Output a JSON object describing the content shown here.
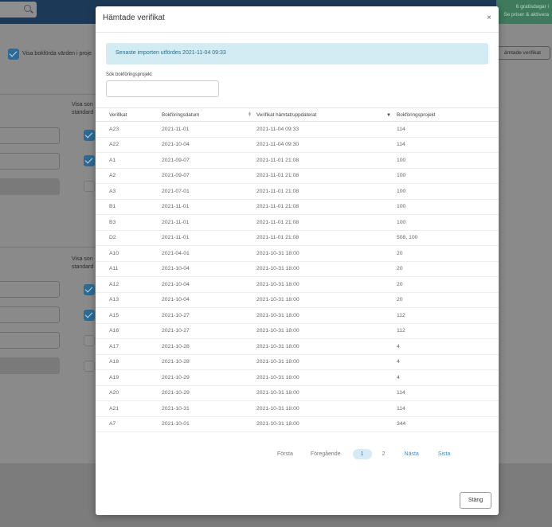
{
  "background": {
    "promo_line1": "6 gratisdagar i",
    "promo_line2": "Se priser & aktivera",
    "checkbox_label": "Visa bokförda värden i proje",
    "col_label_a1": "Visa son",
    "col_label_a2": "standard",
    "col_label_b1": "Visa son",
    "col_label_b2": "standard",
    "right_button": "ämtade verifikat"
  },
  "modal": {
    "title": "Hämtade verifikat",
    "close_glyph": "×",
    "alert_text": "Senaste importen utfördes 2021-11-04 09:33",
    "search_label": "Sök bokföringsprojekt",
    "search_value": "",
    "columns": [
      "Verifikat",
      "Bokföringsdatum",
      "Verifikat hämtat/uppdaterat",
      "Bokföringsprojekt"
    ],
    "rows": [
      [
        "A23",
        "2021-11-01",
        "2021-11-04 09:33",
        "114"
      ],
      [
        "A22",
        "2021-10-04",
        "2021-11-04 09:30",
        "114"
      ],
      [
        "A1",
        "2021-09-07",
        "2021-11-01 21:08",
        "100"
      ],
      [
        "A2",
        "2021-09-07",
        "2021-11-01 21:08",
        "100"
      ],
      [
        "A3",
        "2021-07-01",
        "2021-11-01 21:08",
        "100"
      ],
      [
        "B1",
        "2021-11-01",
        "2021-11-01 21:08",
        "100"
      ],
      [
        "B3",
        "2021-11-01",
        "2021-11-01 21:08",
        "100"
      ],
      [
        "D2",
        "2021-11-01",
        "2021-11-01 21:08",
        "508, 100"
      ],
      [
        "A10",
        "2021-04-01",
        "2021-10-31 18:00",
        "20"
      ],
      [
        "A11",
        "2021-10-04",
        "2021-10-31 18:00",
        "20"
      ],
      [
        "A12",
        "2021-10-04",
        "2021-10-31 18:00",
        "20"
      ],
      [
        "A13",
        "2021-10-04",
        "2021-10-31 18:00",
        "20"
      ],
      [
        "A15",
        "2021-10-27",
        "2021-10-31 18:00",
        "112"
      ],
      [
        "A16",
        "2021-10-27",
        "2021-10-31 18:00",
        "112"
      ],
      [
        "A17",
        "2021-10-28",
        "2021-10-31 18:00",
        "4"
      ],
      [
        "A18",
        "2021-10-28",
        "2021-10-31 18:00",
        "4"
      ],
      [
        "A19",
        "2021-10-29",
        "2021-10-31 18:00",
        "4"
      ],
      [
        "A20",
        "2021-10-29",
        "2021-10-31 18:00",
        "114"
      ],
      [
        "A21",
        "2021-10-31",
        "2021-10-31 18:00",
        "114"
      ],
      [
        "A7",
        "2021-10-01",
        "2021-10-31 18:00",
        "344"
      ]
    ],
    "pagination": {
      "first": "Första",
      "previous": "Föregående",
      "page1": "1",
      "page2": "2",
      "next": "Nästa",
      "last": "Sista"
    },
    "close_button": "Stäng"
  }
}
